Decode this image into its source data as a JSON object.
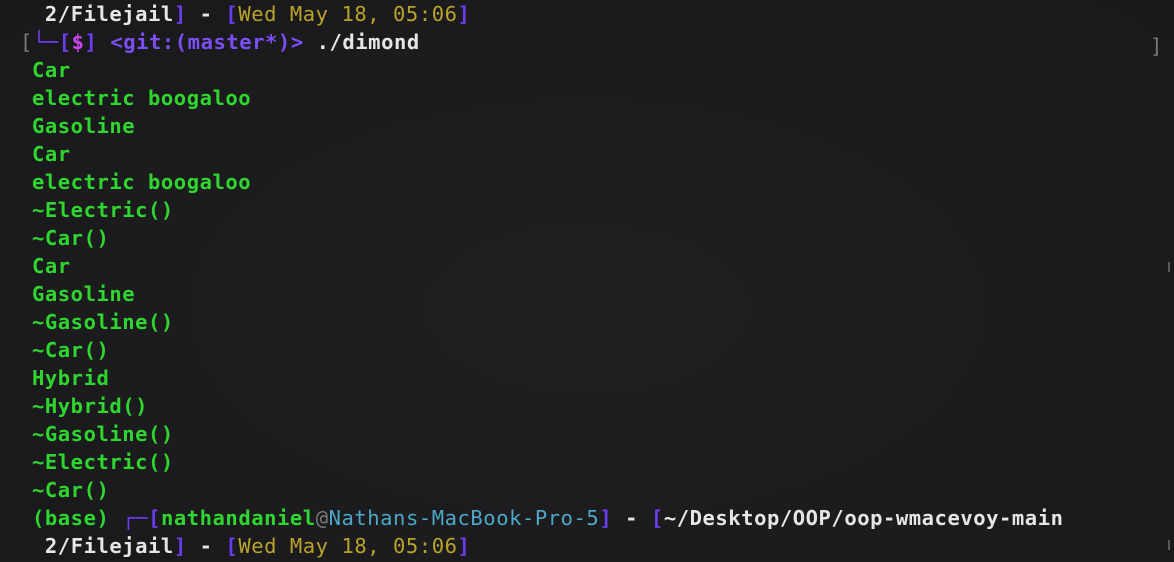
{
  "top_status": {
    "indent": " ",
    "session": "2/Filejail",
    "bracket_close": "]",
    "dash": " - ",
    "bracket_open": "[",
    "datetime": "Wed May 18, 05:06",
    "datetime_close": "]"
  },
  "command_line": {
    "outer_open": "[",
    "corner": "└─",
    "prompt_open": "[",
    "prompt_symbol": "$",
    "prompt_close": "]",
    "space": " ",
    "git_label": "<git:(master*)>",
    "command": " ./dimond",
    "outer_close": "]"
  },
  "output": [
    "Car",
    "electric boogaloo",
    "Gasoline",
    "Car",
    "electric boogaloo",
    "~Electric()",
    "~Car()",
    "Car",
    "Gasoline",
    "~Gasoline()",
    "~Car()",
    "Hybrid",
    "~Hybrid()",
    "~Gasoline()",
    "~Electric()",
    "~Car()"
  ],
  "next_prompt": {
    "env": "(base)",
    "gap": " ",
    "corner": "┌─",
    "user_open": "[",
    "user": "nathandaniel",
    "at": "@",
    "host": "Nathans-MacBook-Pro-5",
    "user_close": "]",
    "dash": " - ",
    "path_open": "[",
    "path": "~/Desktop/OOP/oop-wmacevoy-main"
  },
  "bottom_status": {
    "indent": " ",
    "session": "2/Filejail",
    "bracket_close": "]",
    "dash": " - ",
    "bracket_open": "[",
    "datetime": "Wed May 18, 05:06",
    "datetime_close": "]"
  },
  "colors": {
    "background": "#1c1c1e",
    "output_text": "#2fd62f",
    "session_text": "#e6e6e6",
    "bracket": "#6b3cf0",
    "prompt_symbol": "#ce44ee",
    "datetime": "#b9a32a",
    "host": "#4ca7c8"
  }
}
